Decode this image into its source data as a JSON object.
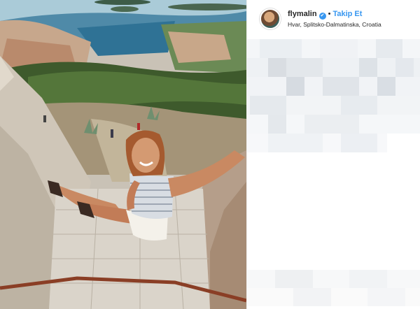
{
  "post": {
    "username": "flymalin",
    "verified_glyph": "✔",
    "separator": "•",
    "follow_label": "Takip Et",
    "location": "Hvar, Splitsko-Dalmatinska, Croatia",
    "avatar_icon": "user-avatar-photo",
    "photo_icon": "travel-photo"
  },
  "colors": {
    "follow_blue": "#3897f0",
    "text_dark": "#262626",
    "border": "#efefef"
  }
}
